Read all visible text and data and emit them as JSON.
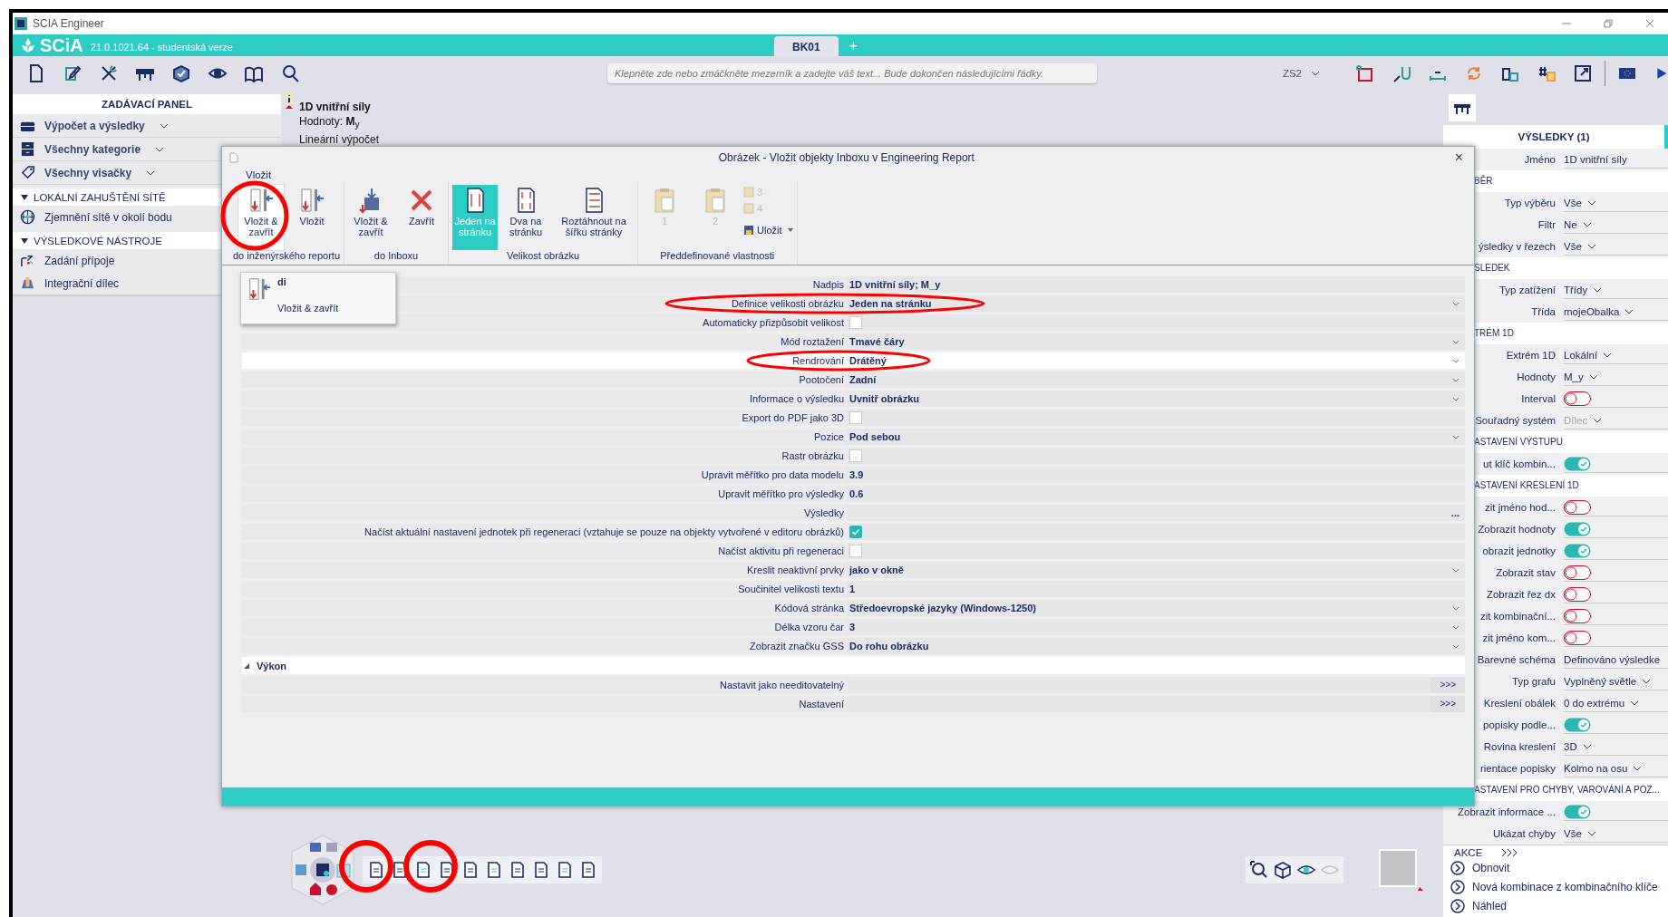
{
  "window": {
    "title": "SCIA Engineer"
  },
  "app_header": {
    "logo": "SCiA",
    "version": "21.0.1021.64 - studentská verze",
    "tabs": [
      {
        "label": "BK01",
        "selected": true
      }
    ],
    "new_tab": "+"
  },
  "toolbar": {
    "search": {
      "placeholder": "Klepněte zde nebo zmáčkněte mezerník a zadejte váš text... Bude dokončen následujícími řádky."
    },
    "coordinate_system": "ZS2"
  },
  "left_panel": {
    "title": "ZADÁVACÍ PANEL",
    "filters": [
      "Výpočet a výsledky",
      "Všechny kategorie",
      "Všechny visačky"
    ],
    "sections": [
      {
        "title": "LOKÁLNÍ ZAHUŠTĚNÍ SÍTĚ",
        "expanded": true,
        "items": [
          "Zjemnění sítě v okolí bodu"
        ]
      },
      {
        "title": "VÝSLEDKOVÉ NÁSTROJE",
        "expanded": true,
        "items": [
          "Zadání přípoje",
          "Integrační dílec"
        ]
      }
    ]
  },
  "viewport": {
    "title": "1D vnitřní síly",
    "values": "Hodnoty: **M**$_{y}$",
    "analysis": "Lineární výpočet"
  },
  "dialog": {
    "title": "Obrázek - Vložit objekty Inboxu v Engineering Report",
    "close": "×",
    "tab": "Vložit",
    "groups": [
      {
        "label": "do inženýrského reportu",
        "buttons": [
          {
            "kind": "large",
            "label": "Vložit & zavřít",
            "selected": false,
            "focused": true,
            "disabled": false
          },
          {
            "kind": "large",
            "label": "Vložit",
            "selected": false,
            "focused": false,
            "disabled": false
          }
        ]
      },
      {
        "label": "do Inboxu",
        "buttons": [
          {
            "kind": "large",
            "label": "Vložit & zavřít",
            "selected": false,
            "focused": false,
            "disabled": false
          },
          {
            "kind": "large",
            "label": "Zavřít",
            "selected": false,
            "focused": false,
            "disabled": false
          }
        ]
      },
      {
        "label": "Velikost obrázku",
        "buttons": [
          {
            "kind": "large",
            "label": "Jeden na stránku",
            "selected": true,
            "focused": false,
            "disabled": false
          },
          {
            "kind": "large",
            "label": "Dva na stránku",
            "selected": false,
            "focused": false,
            "disabled": false
          },
          {
            "kind": "large",
            "label": "Roztáhnout na šířku stránky",
            "selected": false,
            "focused": false,
            "disabled": false
          }
        ]
      },
      {
        "label": "Předdefinované vlastnosti",
        "buttons": [
          {
            "kind": "large",
            "label": "1",
            "selected": false,
            "focused": false,
            "disabled": true
          },
          {
            "kind": "large",
            "label": "2",
            "selected": false,
            "focused": false,
            "disabled": true
          },
          {
            "kind": "small",
            "label": "3",
            "disabled": true
          },
          {
            "kind": "small",
            "label": "4",
            "disabled": true
          },
          {
            "kind": "split",
            "label": "Uložit",
            "disabled": false
          }
        ]
      }
    ],
    "menu": {
      "title": "di",
      "label": "Vložit & zavřít"
    },
    "properties": [
      {
        "label": "Nadpis",
        "kind": "text",
        "value": "1D vnitřní síly; M_y",
        "selected": false
      },
      {
        "label": "Definice velikosti obrázku",
        "kind": "select",
        "value": "Jeden na stránku",
        "selected": false
      },
      {
        "label": "Automaticky přizpůsobit velikost",
        "kind": "check",
        "checked": false,
        "selected": false
      },
      {
        "label": "Mód roztažení",
        "kind": "select",
        "value": "Tmavé čáry",
        "selected": false
      },
      {
        "label": "Rendrování",
        "kind": "select",
        "value": "Drátěný",
        "selected": true
      },
      {
        "label": "Pootočení",
        "kind": "select",
        "value": "Zadní",
        "selected": false
      },
      {
        "label": "Informace o výsledku",
        "kind": "select",
        "value": "Uvnitř obrázku",
        "selected": false
      },
      {
        "label": "Export do PDF jako 3D",
        "kind": "check",
        "checked": false,
        "selected": false
      },
      {
        "label": "Pozice",
        "kind": "select",
        "value": "Pod sebou",
        "selected": false
      },
      {
        "label": "Rastr obrázku",
        "kind": "check",
        "checked": false,
        "selected": false
      },
      {
        "label": "Upravit měřítko pro data modelu",
        "kind": "text",
        "value": "3.9",
        "selected": false
      },
      {
        "label": "Upravit měřítko pro výsledky",
        "kind": "text",
        "value": "0.6",
        "selected": false
      },
      {
        "label": "Výsledky",
        "kind": "button",
        "action": "...",
        "selected": false
      },
      {
        "label": "Načíst aktuální nastavení jednotek při regeneraci (vztahuje se pouze na objekty vytvořené v editoru obrázků)",
        "kind": "check",
        "checked": true,
        "selected": false
      },
      {
        "label": "Načíst aktivitu při regeneraci",
        "kind": "check",
        "checked": false,
        "selected": false
      },
      {
        "label": "Kreslit neaktivní prvky",
        "kind": "select",
        "value": "jako v okně",
        "selected": false
      },
      {
        "label": "Součinitel velikosti textu",
        "kind": "text",
        "value": "1",
        "selected": false
      },
      {
        "label": "Kódová stránka",
        "kind": "select",
        "value": "Středoevropské jazyky (Windows-1250)",
        "selected": false
      },
      {
        "label": "Délka vzoru čar",
        "kind": "select",
        "value": "3",
        "selected": false
      },
      {
        "label": "Zobrazit značku GSS",
        "kind": "select",
        "value": "Do rohu obrázku",
        "selected": false
      }
    ],
    "sections": [
      {
        "title": "Výkon",
        "expanded": true,
        "rows": [
          {
            "label": "Nastavit jako needitovatelný",
            "action": ">>>"
          },
          {
            "label": "Nastavení",
            "action": ">>>"
          }
        ]
      }
    ]
  },
  "right_panel": {
    "title": "VÝSLEDKY (1)",
    "rows": [
      {
        "kind": "value",
        "label": "Jméno",
        "value": "1D vnitřní síly"
      },
      {
        "kind": "header",
        "label": "BĚR"
      },
      {
        "kind": "select",
        "label": "Typ výběru",
        "value": "Vše",
        "disabled": false
      },
      {
        "kind": "select",
        "label": "Filtr",
        "value": "Ne",
        "disabled": false
      },
      {
        "kind": "select",
        "label": "ýsledky v řezech",
        "value": "Vše",
        "disabled": false
      },
      {
        "kind": "header",
        "label": "SLEDEK"
      },
      {
        "kind": "select",
        "label": "Typ zatížení",
        "value": "Třídy",
        "disabled": false
      },
      {
        "kind": "select",
        "label": "Třída",
        "value": "mojeObalka",
        "disabled": false
      },
      {
        "kind": "header",
        "label": "TRÉM 1D"
      },
      {
        "kind": "select",
        "label": "Extrém 1D",
        "value": "Lokální",
        "disabled": false
      },
      {
        "kind": "select",
        "label": "Hodnoty",
        "value": "M_y",
        "disabled": false
      },
      {
        "kind": "toggle",
        "label": "Interval",
        "on": false
      },
      {
        "kind": "select",
        "label": "Souřadný systém",
        "value": "Dílec",
        "disabled": true
      },
      {
        "kind": "header",
        "label": "ASTAVENÍ VÝSTUPU"
      },
      {
        "kind": "toggle",
        "label": "ut klíč kombin...",
        "on": true
      },
      {
        "kind": "header",
        "label": "ASTAVENÍ KRESLENÍ 1D"
      },
      {
        "kind": "toggle",
        "label": "zit jméno hod...",
        "on": false
      },
      {
        "kind": "toggle",
        "label": "Zobrazit hodnoty",
        "on": true
      },
      {
        "kind": "toggle",
        "label": "obrazit jednotky",
        "on": true
      },
      {
        "kind": "toggle",
        "label": "Zobrazit stav",
        "on": false
      },
      {
        "kind": "toggle",
        "label": "Zobrazit řez dx",
        "on": false
      },
      {
        "kind": "toggle",
        "label": "zit kombinační...",
        "on": false
      },
      {
        "kind": "toggle",
        "label": "zit jméno kom...",
        "on": false
      },
      {
        "kind": "value",
        "label": "Barevné schéma",
        "value": "Definováno výsledke"
      },
      {
        "kind": "select",
        "label": "Typ grafu",
        "value": "Vyplněný světle",
        "disabled": false
      },
      {
        "kind": "select",
        "label": "Kreslení obálek",
        "value": "0 do extrému",
        "disabled": false
      },
      {
        "kind": "toggle",
        "label": "popisky podle...",
        "on": true
      },
      {
        "kind": "select",
        "label": "Rovina kreslení",
        "value": "3D",
        "disabled": false
      },
      {
        "kind": "select",
        "label": "rientace popisky",
        "value": "Kolmo na osu",
        "disabled": false
      },
      {
        "kind": "header",
        "label": "ASTAVENÍ PRO CHYBY, VAROVÁNÍ A POZ..."
      },
      {
        "kind": "toggle",
        "label": "Zobrazit informace ...",
        "on": true
      },
      {
        "kind": "select",
        "label": "Ukázat chyby",
        "value": "Vše",
        "disabled": false
      }
    ],
    "actions": {
      "title": "AKCE",
      "items": [
        "Obnovit",
        "Nová kombinace z kombinačního klíče",
        "Náhled"
      ]
    }
  }
}
